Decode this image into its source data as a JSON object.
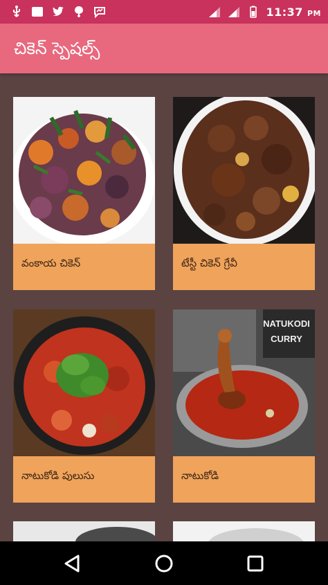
{
  "status_bar": {
    "time": "11:37",
    "time_suffix": "PM",
    "left_icons": [
      "usb-icon",
      "notification-square-icon",
      "twitter-icon",
      "balloon-icon",
      "chat-icon"
    ],
    "right_icons": [
      "signal-icon",
      "signal-icon",
      "battery-icon"
    ]
  },
  "app_bar": {
    "title": "చికెన్ స్పెషల్స్",
    "background": "#e8687e"
  },
  "recipes": [
    {
      "label": "వంకాయ చికెన్"
    },
    {
      "label": "టేస్టీ చికెన్ గ్రేవీ"
    },
    {
      "label": "నాటుకోడి పులుసు"
    },
    {
      "label": "నాటుకోడి"
    }
  ],
  "decorative_image_text": "NATUKODI CURRY",
  "nav_bar": {
    "buttons": [
      "back-icon",
      "home-icon",
      "recents-icon"
    ]
  },
  "colors": {
    "status_bar": "#c9325c",
    "content_background": "#5b4342",
    "card_label_background": "#f0a35a"
  }
}
